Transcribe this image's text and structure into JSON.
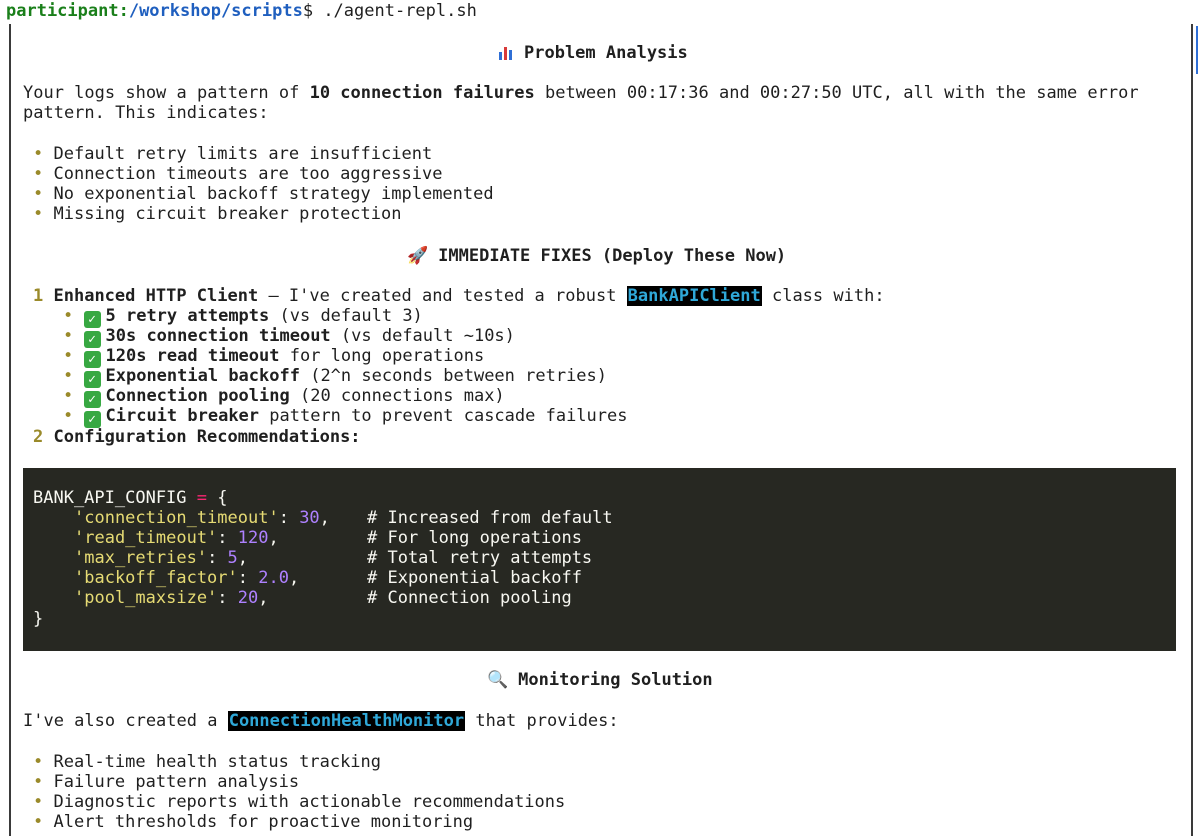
{
  "prompt": {
    "user": "participant:",
    "path": "/workshop/scripts",
    "symbol": "$ ",
    "command": "./agent-repl.sh"
  },
  "problem": {
    "icon": "bar-chart-icon",
    "title": "Problem Analysis",
    "intro_pre": "Your logs show a pattern of ",
    "intro_bold": "10 connection failures",
    "intro_post": " between 00:17:36 and 00:27:50 UTC, all with the same error",
    "intro_line2": "pattern. This indicates:",
    "bullets": [
      "Default retry limits are insufficient",
      "Connection timeouts are too aggressive",
      "No exponential backoff strategy implemented",
      "Missing circuit breaker protection"
    ]
  },
  "fixes": {
    "icon": "rocket-icon",
    "title": "IMMEDIATE FIXES (Deploy These Now)",
    "item1": {
      "num": "1",
      "bold": "Enhanced HTTP Client",
      "mid": " – I've created and tested a robust ",
      "tag": "BankAPIClient",
      "post": " class with:"
    },
    "checks": [
      {
        "bold": "5 retry attempts",
        "rest": " (vs default 3)"
      },
      {
        "bold": "30s connection timeout",
        "rest": " (vs default ~10s)"
      },
      {
        "bold": "120s read timeout",
        "rest": " for long operations"
      },
      {
        "bold": "Exponential backoff",
        "rest": " (2^n seconds between retries)"
      },
      {
        "bold": "Connection pooling",
        "rest": " (20 connections max)"
      },
      {
        "bold": "Circuit breaker",
        "rest": " pattern to prevent cascade failures"
      }
    ],
    "item2": {
      "num": "2",
      "bold": "Configuration Recommendations:"
    }
  },
  "code": {
    "var": "BANK_API_CONFIG",
    "eq": " = ",
    "open": "{",
    "close": "}",
    "entries": [
      {
        "key": "'connection_timeout'",
        "value": "30",
        "comment": "# Increased from default"
      },
      {
        "key": "'read_timeout'",
        "value": "120",
        "comment": "# For long operations"
      },
      {
        "key": "'max_retries'",
        "value": "5",
        "comment": "# Total retry attempts"
      },
      {
        "key": "'backoff_factor'",
        "value": "2.0",
        "comment": "# Exponential backoff"
      },
      {
        "key": "'pool_maxsize'",
        "value": "20",
        "comment": "# Connection pooling"
      }
    ]
  },
  "monitoring": {
    "icon": "magnifier-icon",
    "title": "Monitoring Solution",
    "intro_pre": "I've also created a ",
    "intro_tag": "ConnectionHealthMonitor",
    "intro_post": " that provides:",
    "bullets": [
      "Real-time health status tracking",
      "Failure pattern analysis",
      "Diagnostic reports with actionable recommendations",
      "Alert thresholds for proactive monitoring"
    ]
  },
  "colors": {
    "prompt_user": "#1a7f1a",
    "prompt_path": "#1f5fbf",
    "code_bg": "#272822",
    "check_bg": "#37a842",
    "tag_text": "#2fa8d8"
  }
}
